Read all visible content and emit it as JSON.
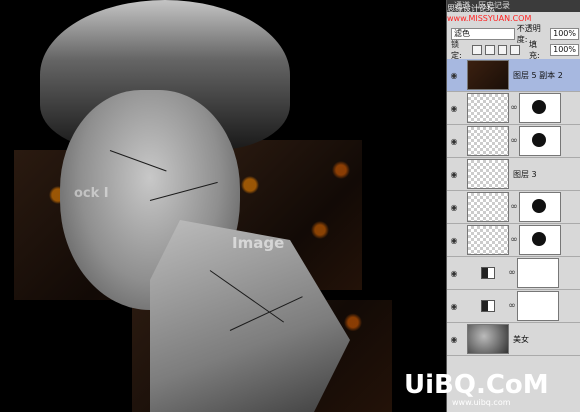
{
  "panel": {
    "tabs": [
      "通道",
      "历史记录"
    ],
    "site_mark_prefix": "思缘设计论坛",
    "site_mark_url": "www.MISSYUAN.COM",
    "blend_mode": "滤色",
    "opacity_label": "不透明度:",
    "opacity_value": "100%",
    "lock_label": "锁定:",
    "fill_label": "填充:",
    "fill_value": "100%",
    "layers": [
      {
        "name": "图层 5 副本 2",
        "selected": true,
        "thumb": "dark",
        "has_mask": false
      },
      {
        "name": "",
        "selected": false,
        "thumb": "checker",
        "has_mask": true
      },
      {
        "name": "",
        "selected": false,
        "thumb": "checker",
        "has_mask": true
      },
      {
        "name": "图层 3",
        "selected": false,
        "thumb": "checker",
        "has_mask": false
      },
      {
        "name": "",
        "selected": false,
        "thumb": "checker",
        "has_mask": true
      },
      {
        "name": "",
        "selected": false,
        "thumb": "checker",
        "has_mask": true
      },
      {
        "name": "",
        "selected": false,
        "thumb": "adjust",
        "has_mask": true
      },
      {
        "name": "",
        "selected": false,
        "thumb": "adjust",
        "has_mask": true
      },
      {
        "name": "美女",
        "selected": false,
        "thumb": "portrait",
        "has_mask": false
      }
    ]
  },
  "canvas": {
    "watermark": "Image",
    "watermark_left": "ock I"
  },
  "footer_logo": {
    "brand": "UiBQ.CoM",
    "url": "www.uibq.com"
  }
}
